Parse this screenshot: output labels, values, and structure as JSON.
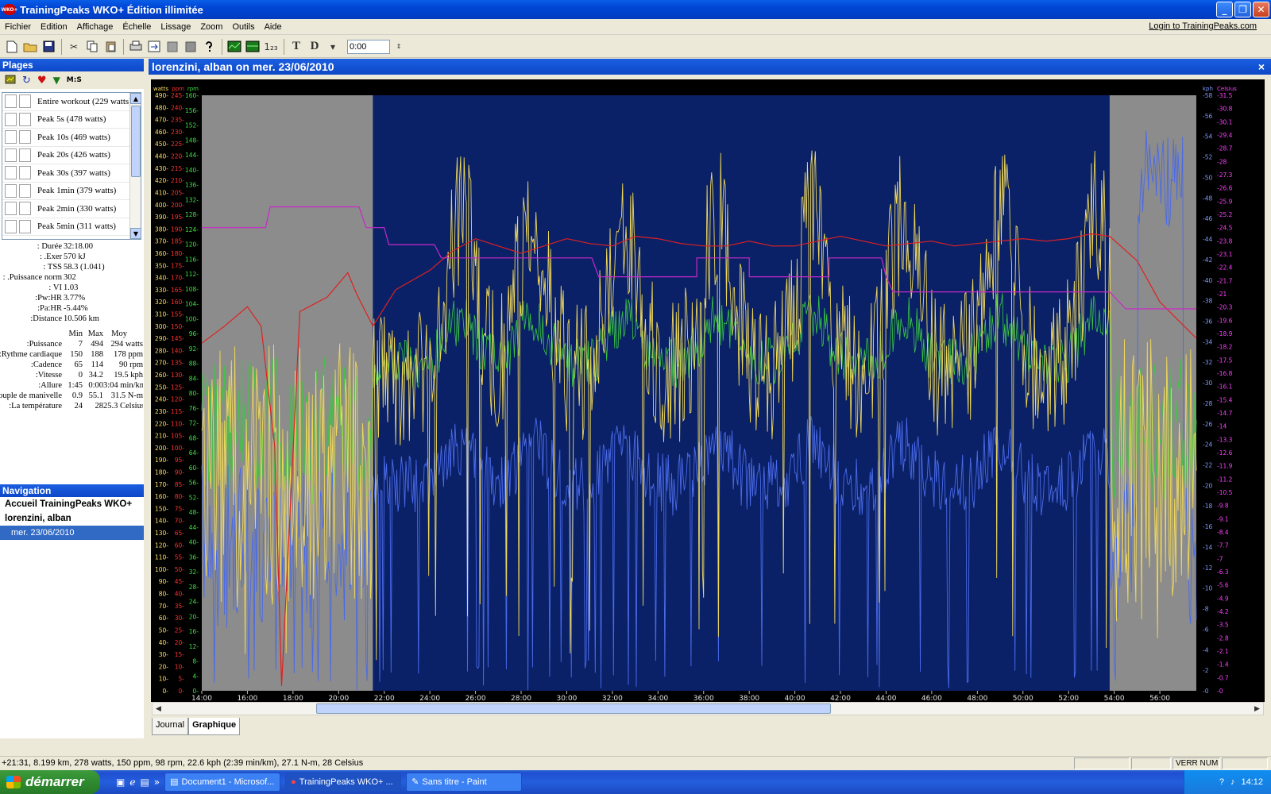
{
  "window": {
    "title": "TrainingPeaks WKO+ Édition illimitée",
    "logo_text": "WKO+",
    "minimize": "_",
    "maximize": "❐",
    "close": "✕"
  },
  "menu": [
    "Fichier",
    "Edition",
    "Affichage",
    "Échelle",
    "Lissage",
    "Zoom",
    "Outils",
    "Aide"
  ],
  "login_link": "Login to TrainingPeaks.com",
  "toolbar": {
    "t_label": "T",
    "d_label": "D",
    "num_label": "1₂₃",
    "time_value": "0:00"
  },
  "plages": {
    "title": "Plages",
    "tool_ms": "M:S",
    "ranges": [
      "Entire workout (229 watts)",
      "Peak 5s (478 watts)",
      "Peak 10s (469 watts)",
      "Peak 20s (426 watts)",
      "Peak 30s (397 watts)",
      "Peak 1min (379 watts)",
      "Peak 2min (330 watts)",
      "Peak 5min (311 watts)"
    ]
  },
  "stats": {
    "lines": [
      {
        "label": "Durée :",
        "value": "32:18.00"
      },
      {
        "label": "Exer. :",
        "value": "570 kJ"
      },
      {
        "label": "TSS :",
        "value": "58.3 (1.041)"
      },
      {
        "label": "Puissance norm. :",
        "value": "302"
      },
      {
        "label": "VI :",
        "value": "1.03"
      },
      {
        "label": "Pw:HR:",
        "value": "3.77%"
      },
      {
        "label": "Pa:HR:",
        "value": "-5.44%"
      },
      {
        "label": "Distance:",
        "value": "10.506 km"
      }
    ],
    "minmax_headers": [
      "Min",
      "Max",
      "Moy"
    ],
    "minmax": [
      {
        "label": "Puissance:",
        "min": "7",
        "max": "494",
        "avg": "294 watts"
      },
      {
        "label": "Rythme cardiaque:",
        "min": "150",
        "max": "188",
        "avg": "178 ppm"
      },
      {
        "label": "Cadence:",
        "min": "65",
        "max": "114",
        "avg": "90 rpm"
      },
      {
        "label": "Vitesse:",
        "min": "0",
        "max": "34.2",
        "avg": "19.5 kph"
      },
      {
        "label": "Allure:",
        "min": "1:45",
        "max": "0:00",
        "avg": "3:04 min/km"
      },
      {
        "label": "Couple de manivelle:",
        "min": "0.9",
        "max": "55.1",
        "avg": "31.5 N-m"
      },
      {
        "label": "La température:",
        "min": "24",
        "max": "28",
        "avg": "25.3 Celsius"
      }
    ]
  },
  "navigation": {
    "title": "Navigation",
    "items": [
      "Accueil TrainingPeaks WKO+",
      "lorenzini, alban"
    ],
    "selected": "mer. 23/06/2010"
  },
  "document": {
    "title": "lorenzini, alban on mer. 23/06/2010",
    "close": "×",
    "tabs": [
      "Journal",
      "Graphique"
    ],
    "active_tab": "Graphique"
  },
  "chart_data": {
    "type": "line",
    "title": "",
    "plot_bg": "#0a2168",
    "unselected_bg": "#8c8c8c",
    "x_ticks": [
      "14:00",
      "16:00",
      "18:00",
      "20:00",
      "22:00",
      "24:00",
      "26:00",
      "28:00",
      "30:00",
      "32:00",
      "34:00",
      "36:00",
      "38:00",
      "40:00",
      "42:00",
      "44:00",
      "46:00",
      "48:00",
      "50:00",
      "52:00",
      "54:00",
      "56:00"
    ],
    "x_range_minutes": [
      14,
      57.6
    ],
    "selection_minutes": [
      21.5,
      53.8
    ],
    "axes": [
      {
        "unit": "watts",
        "color": "#ffe060",
        "min": 0,
        "max": 490,
        "step": 10,
        "side": "left"
      },
      {
        "unit": "ppm",
        "color": "#ff3030",
        "min": 0,
        "max": 245,
        "step": 5,
        "side": "left"
      },
      {
        "unit": "rpm",
        "color": "#40e040",
        "min": 0,
        "max": 160,
        "step": 4,
        "side": "left"
      },
      {
        "unit": "kph",
        "color": "#7f9cff",
        "min": 0,
        "max": 58,
        "step": 2,
        "side": "right"
      },
      {
        "unit": "Celsius",
        "color": "#ff40ff",
        "min": 0,
        "max": 31.5,
        "step": 0.7,
        "side": "right"
      }
    ],
    "series": [
      {
        "unit": "watts",
        "color": "#f0d85a",
        "sample_minutes_step": 0.1,
        "values": []
      },
      {
        "unit": "ppm",
        "color": "#e02020",
        "points": [
          [
            14,
            143
          ],
          [
            15,
            150
          ],
          [
            16,
            158
          ],
          [
            16.6,
            150
          ],
          [
            17.2,
            100
          ],
          [
            17.5,
            2
          ],
          [
            18.3,
            156
          ],
          [
            19.5,
            162
          ],
          [
            20.4,
            172
          ],
          [
            20.8,
            163
          ],
          [
            21.5,
            150
          ],
          [
            22.5,
            165
          ],
          [
            24,
            173
          ],
          [
            25,
            181
          ],
          [
            26,
            186
          ],
          [
            27,
            183
          ],
          [
            28,
            180
          ],
          [
            29,
            183
          ],
          [
            30,
            186
          ],
          [
            31,
            184
          ],
          [
            32,
            183
          ],
          [
            33,
            187
          ],
          [
            34,
            186
          ],
          [
            35,
            184
          ],
          [
            36,
            183
          ],
          [
            37,
            183
          ],
          [
            38,
            185
          ],
          [
            39,
            183
          ],
          [
            40,
            183
          ],
          [
            41,
            185
          ],
          [
            42,
            187
          ],
          [
            43,
            185
          ],
          [
            44,
            183
          ],
          [
            45,
            184
          ],
          [
            46,
            185
          ],
          [
            47,
            183
          ],
          [
            48,
            184
          ],
          [
            49,
            185
          ],
          [
            50,
            186
          ],
          [
            51,
            185
          ],
          [
            52,
            186
          ],
          [
            53,
            188
          ],
          [
            53.8,
            187
          ],
          [
            55,
            177
          ],
          [
            56,
            160
          ],
          [
            57.6,
            145
          ]
        ]
      },
      {
        "unit": "rpm",
        "color": "#3cc840",
        "sample_minutes_step": 0.1,
        "values": []
      },
      {
        "unit": "kph",
        "color": "#4a6ae8",
        "sample_minutes_step": 0.1,
        "values": []
      },
      {
        "unit": "Celsius",
        "color": "#c828c8",
        "points": [
          [
            14,
            24.5
          ],
          [
            16.8,
            24.5
          ],
          [
            17,
            25.6
          ],
          [
            17.3,
            25.6
          ],
          [
            17.3,
            25.6
          ],
          [
            20.9,
            25.6
          ],
          [
            21.2,
            24.5
          ],
          [
            22,
            24.5
          ],
          [
            22.2,
            23.6
          ],
          [
            24.2,
            23.6
          ],
          [
            24.5,
            22.9
          ],
          [
            27,
            22.9
          ],
          [
            29,
            22.9
          ],
          [
            31.1,
            22.9
          ],
          [
            31.4,
            21.9
          ],
          [
            34.5,
            21.9
          ],
          [
            35,
            21.9
          ],
          [
            35.7,
            21.9
          ],
          [
            35.7,
            22.9
          ],
          [
            38,
            22.9
          ],
          [
            38,
            21.9
          ],
          [
            41.5,
            21.9
          ],
          [
            41.5,
            22.9
          ],
          [
            43.8,
            22.9
          ],
          [
            44,
            21.9
          ],
          [
            44.3,
            21.1
          ],
          [
            50,
            21.1
          ],
          [
            53.8,
            21.1
          ],
          [
            54.5,
            20.2
          ],
          [
            57.6,
            20.2
          ]
        ]
      }
    ]
  },
  "statusbar": {
    "text": "+21:31, 8.199 km, 278 watts, 150 ppm, 98 rpm, 22.6 kph (2:39 min/km), 27.1 N-m, 28 Celsius",
    "num_lock": "VERR NUM"
  },
  "taskbar": {
    "start": "démarrer",
    "tasks": [
      "Document1 - Microsof...",
      "TrainingPeaks WKO+ ...",
      "Sans titre - Paint"
    ],
    "active_task": 1,
    "clock": "14:12"
  }
}
